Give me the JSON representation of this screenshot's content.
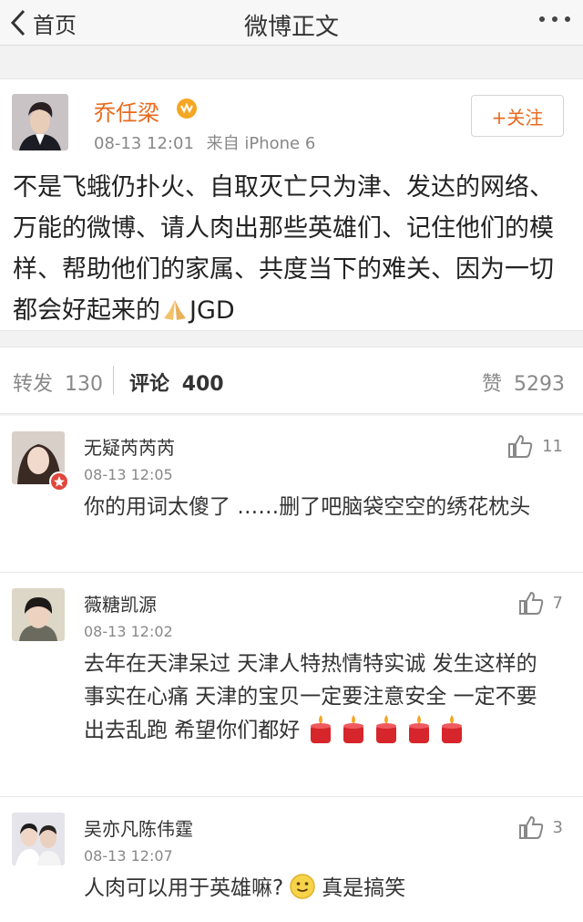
{
  "nav": {
    "back_label": "首页",
    "title": "微博正文"
  },
  "post": {
    "author": "乔任梁",
    "time": "08-13 12:01",
    "source": "来自 iPhone 6",
    "follow_label": "+关注",
    "text": "不是飞蛾仍扑火、自取灭亡只为津、发达的网络、万能的微博、请人肉出那些英雄们、记住他们的模样、帮助他们的家属、共度当下的难关、因为一切都会好起来的",
    "text_suffix": "JGD"
  },
  "tabs": {
    "repost_label": "转发",
    "repost_count": "130",
    "comment_label": "评论",
    "comment_count": "400",
    "like_label": "赞",
    "like_count": "5293"
  },
  "comments": [
    {
      "name": "无疑芮芮芮",
      "time": "08-13 12:05",
      "likes": "11",
      "text": "你的用词太傻了 ……删了吧脑袋空空的绣花枕头"
    },
    {
      "name": "薇糖凯源",
      "time": "08-13 12:02",
      "likes": "7",
      "text": "去年在天津呆过 天津人特热情特实诚 发生这样的事实在心痛 天津的宝贝一定要注意安全 一定不要出去乱跑 希望你们都好"
    },
    {
      "name": "吴亦凡陈伟霆",
      "time": "08-13 12:07",
      "likes": "3",
      "text": "人肉可以用于英雄嘛?",
      "text_after": "真是搞笑"
    }
  ],
  "colors": {
    "accent": "#e86a1e",
    "background": "#f2f2f2"
  }
}
